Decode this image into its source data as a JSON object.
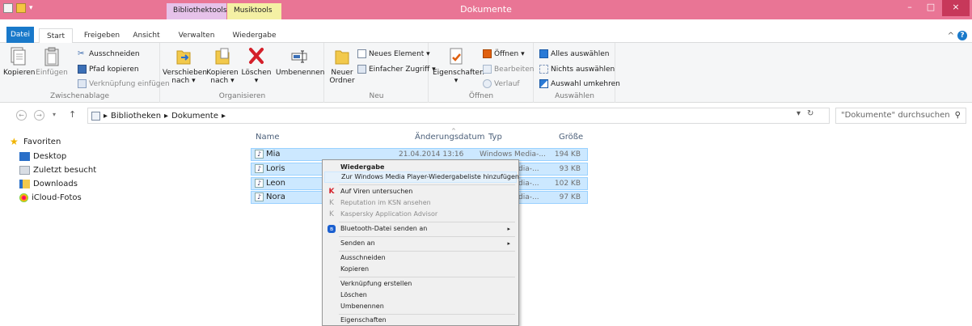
{
  "window": {
    "title": "Dokumente",
    "context_tabs": [
      "Bibliothektools",
      "Musiktools"
    ],
    "controls": [
      "–",
      "□",
      "×"
    ]
  },
  "ribbon_tabs": [
    "Datei",
    "Start",
    "Freigeben",
    "Ansicht",
    "Verwalten",
    "Wiedergabe"
  ],
  "ribbon_right": "^",
  "ribbon": {
    "zwischenablage": {
      "label": "Zwischenablage",
      "kopieren": "Kopieren",
      "einfuegen": "Einfügen",
      "ausschneiden": "Ausschneiden",
      "pfad_kopieren": "Pfad kopieren",
      "verknuepfung_einfuegen": "Verknüpfung einfügen"
    },
    "organisieren": {
      "label": "Organisieren",
      "verschieben": "Verschieben",
      "verschieben_nach": "nach ▾",
      "kopieren": "Kopieren",
      "kopieren_nach": "nach ▾",
      "loeschen": "Löschen",
      "loeschen_arrow": "▾",
      "umbenennen": "Umbenennen"
    },
    "neu": {
      "label": "Neu",
      "neuer_ordner_1": "Neuer",
      "neuer_ordner_2": "Ordner",
      "neues_element": "Neues Element ▾",
      "einfacher_zugriff": "Einfacher Zugriff ▾"
    },
    "oeffnen": {
      "label": "Öffnen",
      "eigenschaften": "Eigenschaften",
      "eigenschaften_arrow": "▾",
      "oeffnen": "Öffnen ▾",
      "bearbeiten": "Bearbeiten",
      "verlauf": "Verlauf"
    },
    "auswaehlen": {
      "label": "Auswählen",
      "alles": "Alles auswählen",
      "nichts": "Nichts auswählen",
      "umkehren": "Auswahl umkehren"
    }
  },
  "address": {
    "back": "←",
    "forward": "→",
    "recent": "▾",
    "up": "↑",
    "crumbs": [
      "▸",
      "Bibliotheken",
      "▸",
      "Dokumente",
      "▸"
    ],
    "dropdown": "▾",
    "refresh": "↻",
    "search_placeholder": "\"Dokumente\" durchsuchen",
    "search_icon": "⚲"
  },
  "nav": {
    "favoriten": "Favoriten",
    "items": [
      "Desktop",
      "Zuletzt besucht",
      "Downloads",
      "iCloud-Fotos"
    ]
  },
  "columns": {
    "name": "Name",
    "date": "Änderungsdatum",
    "type": "Typ",
    "size": "Größe"
  },
  "files": [
    {
      "name": "Mia",
      "date": "21.04.2014 13:16",
      "type": "Windows Media-...",
      "size": "194 KB"
    },
    {
      "name": "Loris",
      "date": "",
      "type": "dia-...",
      "size": "93 KB"
    },
    {
      "name": "Leon",
      "date": "",
      "type": "dia-...",
      "size": "102 KB"
    },
    {
      "name": "Nora",
      "date": "",
      "type": "dia-...",
      "size": "97 KB"
    }
  ],
  "context_menu": {
    "wiedergabe": "Wiedergabe",
    "playlist": "Zur Windows Media Player-Wiedergabeliste hinzufügen",
    "viren": "Auf Viren untersuchen",
    "reputation": "Reputation im KSN ansehen",
    "advisor": "Kaspersky Application Advisor",
    "bluetooth": "Bluetooth-Datei senden an",
    "senden": "Senden an",
    "ausschneiden": "Ausschneiden",
    "kopieren": "Kopieren",
    "verknuepfung": "Verknüpfung erstellen",
    "loeschen": "Löschen",
    "umbenennen": "Umbenennen",
    "eigenschaften": "Eigenschaften",
    "submenu_arrow": "▸"
  },
  "colors": {
    "titlebar": "#e97595",
    "accent": "#1979ca",
    "selection": "#cce8ff"
  }
}
